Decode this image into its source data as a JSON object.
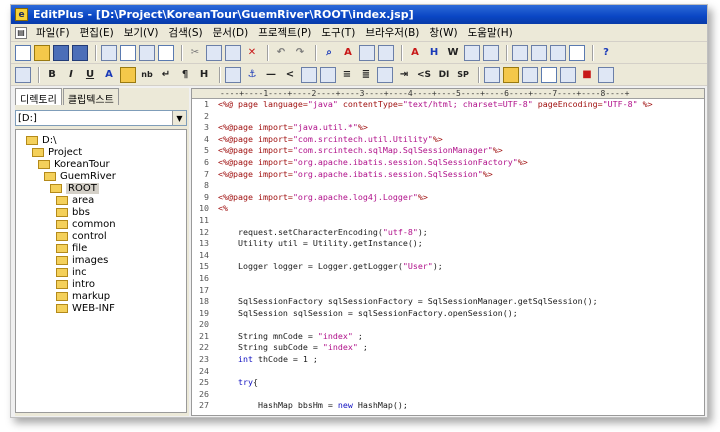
{
  "window": {
    "title": "EditPlus - [D:\\Project\\KoreanTour\\GuemRiver\\ROOT\\index.jsp]",
    "app_icon": "editplus-icon"
  },
  "menu": [
    "파일(F)",
    "편집(E)",
    "보기(V)",
    "검색(S)",
    "문서(D)",
    "프로젝트(P)",
    "도구(T)",
    "브라우저(B)",
    "창(W)",
    "도움말(H)"
  ],
  "toolbar_html": [
    "B",
    "I",
    "U",
    "A",
    "nb",
    "↵",
    "¶",
    "H",
    "<S",
    "DI",
    "SP"
  ],
  "left_panel": {
    "tabs": [
      "디렉토리",
      "클립텍스트"
    ],
    "drive": "[D:]",
    "tree": [
      {
        "label": "D:\\",
        "depth": 0
      },
      {
        "label": "Project",
        "depth": 1
      },
      {
        "label": "KoreanTour",
        "depth": 2
      },
      {
        "label": "GuemRiver",
        "depth": 3
      },
      {
        "label": "ROOT",
        "depth": 4,
        "selected": true
      },
      {
        "label": "area",
        "depth": 5
      },
      {
        "label": "bbs",
        "depth": 5
      },
      {
        "label": "common",
        "depth": 5
      },
      {
        "label": "control",
        "depth": 5
      },
      {
        "label": "file",
        "depth": 5
      },
      {
        "label": "images",
        "depth": 5
      },
      {
        "label": "inc",
        "depth": 5
      },
      {
        "label": "intro",
        "depth": 5
      },
      {
        "label": "markup",
        "depth": 5
      },
      {
        "label": "WEB-INF",
        "depth": 5
      }
    ]
  },
  "editor": {
    "ruler": "----+----1----+----2----+----3----+----4----+----5----+----6----+----7----+----8----+",
    "lines": [
      {
        "n": "1",
        "parts": [
          [
            "dir",
            "<%@ page language="
          ],
          [
            "str",
            "\"java\""
          ],
          [
            "dir",
            " contentType="
          ],
          [
            "str",
            "\"text/html; charset=UTF-8\""
          ],
          [
            "dir",
            " pageEncoding="
          ],
          [
            "str",
            "\"UTF-8\""
          ],
          [
            "dir",
            " %>"
          ]
        ]
      },
      {
        "n": "2",
        "parts": []
      },
      {
        "n": "3",
        "parts": [
          [
            "dir",
            "<%@page import="
          ],
          [
            "str",
            "\"java.util.*\""
          ],
          [
            "dir",
            "%>"
          ]
        ]
      },
      {
        "n": "4",
        "parts": [
          [
            "dir",
            "<%@page import="
          ],
          [
            "str",
            "\"com.srcintech.util.Utility\""
          ],
          [
            "dir",
            "%>"
          ]
        ]
      },
      {
        "n": "5",
        "parts": [
          [
            "dir",
            "<%@page import="
          ],
          [
            "str",
            "\"com.srcintech.sqlMap.SqlSessionManager\""
          ],
          [
            "dir",
            "%>"
          ]
        ]
      },
      {
        "n": "6",
        "parts": [
          [
            "dir",
            "<%@page import="
          ],
          [
            "str",
            "\"org.apache.ibatis.session.SqlSessionFactory\""
          ],
          [
            "dir",
            "%>"
          ]
        ]
      },
      {
        "n": "7",
        "parts": [
          [
            "dir",
            "<%@page import="
          ],
          [
            "str",
            "\"org.apache.ibatis.session.SqlSession\""
          ],
          [
            "dir",
            "%>"
          ]
        ]
      },
      {
        "n": "8",
        "parts": []
      },
      {
        "n": "9",
        "parts": [
          [
            "dir",
            "<%@page import="
          ],
          [
            "str",
            "\"org.apache.log4j.Logger\""
          ],
          [
            "dir",
            "%>"
          ]
        ]
      },
      {
        "n": "10",
        "parts": [
          [
            "dir",
            "<%"
          ]
        ]
      },
      {
        "n": "11",
        "parts": []
      },
      {
        "n": "12",
        "parts": [
          [
            "norm",
            "    request.setCharacterEncoding("
          ],
          [
            "str",
            "\"utf-8\""
          ],
          [
            "norm",
            ");"
          ]
        ]
      },
      {
        "n": "13",
        "parts": [
          [
            "norm",
            "    Utility util = Utility.getInstance();"
          ]
        ]
      },
      {
        "n": "14",
        "parts": []
      },
      {
        "n": "15",
        "parts": [
          [
            "norm",
            "    Logger logger = Logger.getLogger("
          ],
          [
            "str",
            "\"User\""
          ],
          [
            "norm",
            ");"
          ]
        ]
      },
      {
        "n": "16",
        "parts": []
      },
      {
        "n": "17",
        "parts": []
      },
      {
        "n": "18",
        "parts": [
          [
            "norm",
            "    SqlSessionFactory sqlSessionFactory = SqlSessionManager.getSqlSession();"
          ]
        ]
      },
      {
        "n": "19",
        "parts": [
          [
            "norm",
            "    SqlSession sqlSession = sqlSessionFactory.openSession();"
          ]
        ]
      },
      {
        "n": "20",
        "parts": []
      },
      {
        "n": "21",
        "parts": [
          [
            "norm",
            "    String mnCode = "
          ],
          [
            "str",
            "\"index\""
          ],
          [
            "norm",
            " ;"
          ]
        ]
      },
      {
        "n": "22",
        "parts": [
          [
            "norm",
            "    String subCode = "
          ],
          [
            "str",
            "\"index\""
          ],
          [
            "norm",
            " ;"
          ]
        ]
      },
      {
        "n": "23",
        "parts": [
          [
            "kw",
            "    int"
          ],
          [
            "norm",
            " thCode = 1 ;"
          ]
        ]
      },
      {
        "n": "24",
        "parts": []
      },
      {
        "n": "25",
        "parts": [
          [
            "kw",
            "    try"
          ],
          [
            "norm",
            "{"
          ]
        ]
      },
      {
        "n": "26",
        "parts": []
      },
      {
        "n": "27",
        "parts": [
          [
            "norm",
            "        HashMap bbsHm = "
          ],
          [
            "kw",
            "new"
          ],
          [
            "norm",
            " HashMap();"
          ]
        ]
      }
    ]
  }
}
